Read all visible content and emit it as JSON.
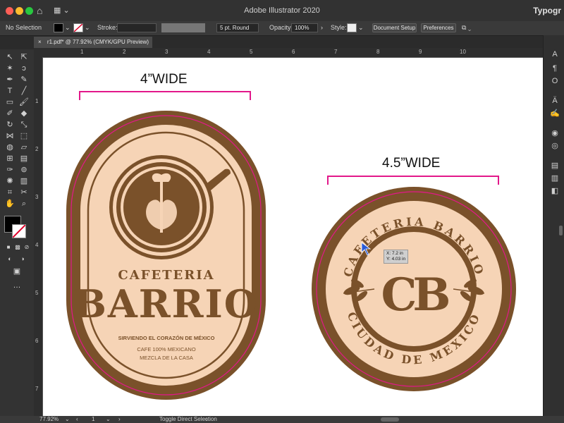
{
  "window": {
    "title": "Adobe Illustrator 2020",
    "workspace": "Typogr"
  },
  "colors": {
    "brown": "#7a512a",
    "cream": "#f6d4b6",
    "guide": "#e2188a"
  },
  "control_bar": {
    "selection": "No Selection",
    "stroke_label": "Stroke:",
    "brush": "5 pt. Round",
    "opacity_label": "Opacity:",
    "opacity_value": "100%",
    "style_label": "Style:",
    "document_setup": "Document Setup",
    "preferences": "Preferences"
  },
  "document_tab": {
    "label": "r1.pdf* @ 77.92% (CMYK/GPU Preview)",
    "close": "×"
  },
  "ruler": {
    "top": [
      "1",
      "2",
      "3",
      "4",
      "5",
      "6",
      "7",
      "8",
      "9",
      "10"
    ],
    "left": [
      "1",
      "2",
      "3",
      "4",
      "5",
      "6",
      "7"
    ]
  },
  "artboard": {
    "left_label": "4”WIDE",
    "right_label": "4.5”WIDE",
    "oval": {
      "word1": "CAFETERIA",
      "word2": "BARRIO",
      "tagline": "SIRVIENDO EL CORAZÓN DE MÉXICO",
      "line1": "CAFE 100% MEXICANO",
      "line2": "MEZCLA DE LA CASA"
    },
    "circle": {
      "top_text": "CAFETERIA BARRIO",
      "bottom_text": "CIUDAD DE MEXICO",
      "monogram": "CB",
      "tooltip_x": "X: 7.2 in",
      "tooltip_y": "Y: 4.03 in"
    }
  },
  "status_bar": {
    "zoom": "77.92%",
    "page": "1",
    "tool_hint": "Toggle Direct Selection"
  }
}
